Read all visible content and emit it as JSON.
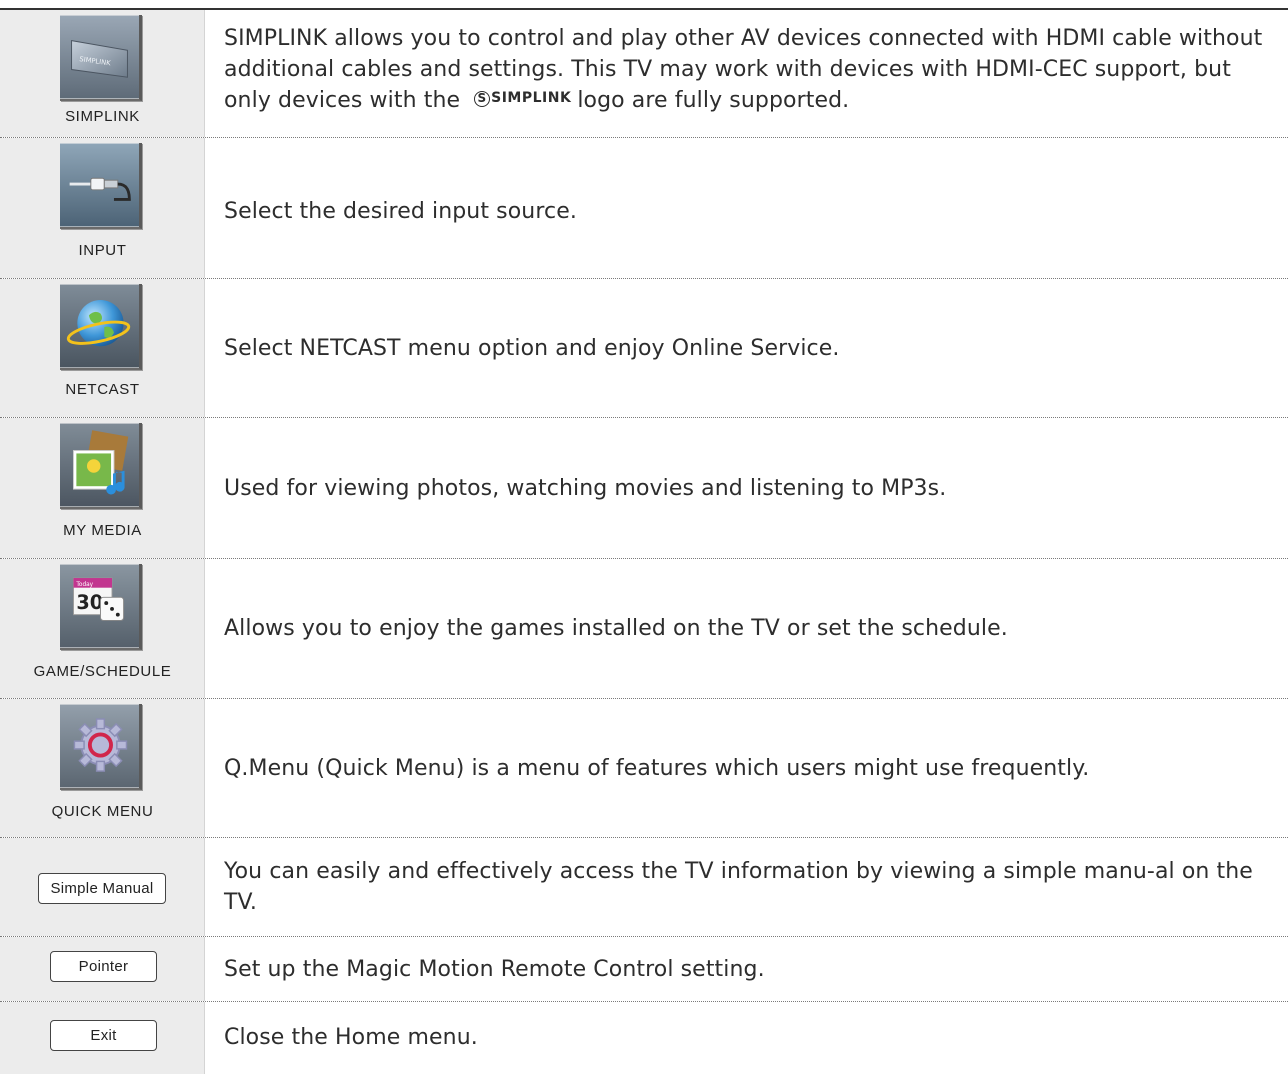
{
  "rows": [
    {
      "label": "SIMPLINK",
      "icon": "simplink-icon",
      "desc_before": "SIMPLINK allows you to control and play other AV devices connected with HDMI cable without additional cables and settings. This TV may work with devices with HDMI-CEC support, but only devices with the",
      "logo_text": "SIMPLINK",
      "desc_after": "logo are fully supported.",
      "icon_text": "SIMPLINK"
    },
    {
      "label": "INPUT",
      "icon": "input-cable-icon",
      "desc": "Select the desired input source."
    },
    {
      "label": "NETCAST",
      "icon": "globe-icon",
      "desc": "Select NETCAST menu option and enjoy Online Service."
    },
    {
      "label": "MY MEDIA",
      "icon": "media-icon",
      "desc": "Used for viewing photos, watching movies and listening to MP3s."
    },
    {
      "label": "GAME/SCHEDULE",
      "icon": "calendar-dice-icon",
      "desc": "Allows you to enjoy the games installed on the TV or set the schedule.",
      "calendar_top": "Today",
      "calendar_day": "30"
    },
    {
      "label": "QUICK MENU",
      "icon": "gear-icon",
      "desc": "Q.Menu (Quick Menu) is a menu of features which users might use frequently."
    },
    {
      "button": "Simple Manual",
      "desc": "You can easily and effectively access the TV information by viewing a simple manu-al on the TV."
    },
    {
      "button": "Pointer",
      "desc": "Set up the Magic Motion Remote Control setting."
    },
    {
      "button": "Exit",
      "desc": "Close the Home menu."
    }
  ]
}
